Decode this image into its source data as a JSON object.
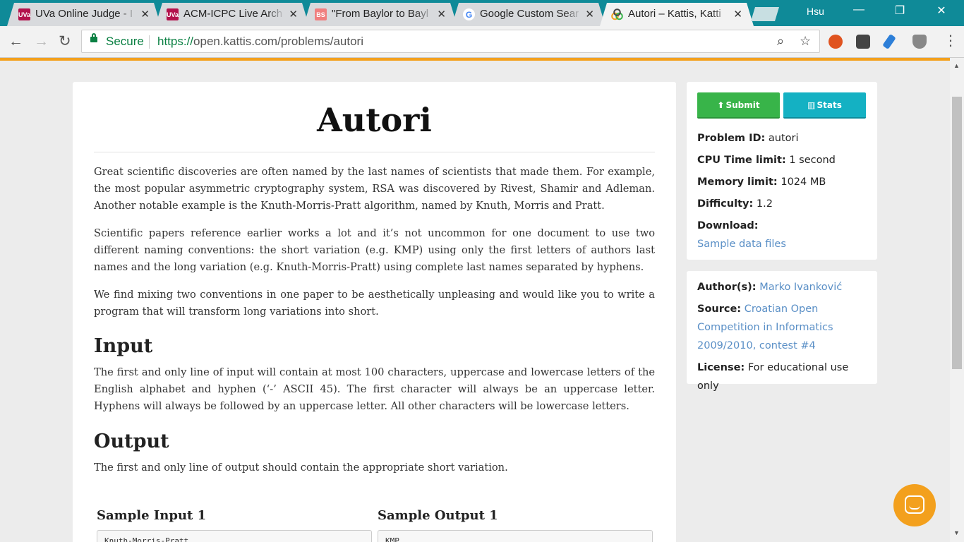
{
  "browser": {
    "tabs": [
      {
        "icon": "uva-favicon",
        "badge": "UVa",
        "color": "#b3124c",
        "title": "UVa Online Judge - I"
      },
      {
        "icon": "uva-favicon",
        "badge": "UVa",
        "color": "#b3124c",
        "title": "ACM-ICPC Live Arch"
      },
      {
        "icon": "bs-favicon",
        "badge": "BS",
        "color": "#f07f7f",
        "title": "\"From Baylor to Bayl"
      },
      {
        "icon": "google-favicon",
        "badge": "G",
        "color": "#4285f4",
        "title": "Google Custom Sear"
      },
      {
        "icon": "kattis-favicon",
        "badge": "",
        "color": "#f3a01d",
        "title": "Autori – Kattis, Katti"
      }
    ],
    "profile_name": "Hsu",
    "secure_label": "Secure",
    "url_scheme": "https://",
    "url_host": "open.kattis.com",
    "url_path": "/problems/autori"
  },
  "colors": {
    "accent": "#f3a01d",
    "submit": "#38b449",
    "stats": "#14b1c3",
    "link": "#5a8fc6"
  },
  "problem": {
    "title": "Autori",
    "intro_p1": "Great scientific discoveries are often named by the last names of scientists that made them. For example, the most popular asymmetric cryptography system, RSA was discovered by Rivest, Shamir and Adleman. Another notable example is the Knuth-Morris-Pratt algorithm, named by Knuth, Morris and Pratt.",
    "intro_p2": "Scientific papers reference earlier works a lot and it’s not uncommon for one document to use two different naming conventions: the short variation (e.g. KMP) using only the first letters of authors last names and the long variation (e.g. Knuth-Morris-Pratt) using complete last names separated by hyphens.",
    "intro_p3": "We find mixing two conventions in one paper to be aesthetically unpleasing and would like you to write a program that will transform long variations into short.",
    "input_heading": "Input",
    "input_text": "The first and only line of input will contain at most 100 characters, uppercase and lowercase letters of the English alphabet and hyphen (‘-’ ASCII 45). The first character will always be an uppercase letter. Hyphens will always be followed by an uppercase letter. All other characters will be lowercase letters.",
    "output_heading": "Output",
    "output_text": "The first and only line of output should contain the appropriate short variation.",
    "sample_input_heading": "Sample Input 1",
    "sample_output_heading": "Sample Output 1",
    "sample_input": "Knuth-Morris-Pratt",
    "sample_output": "KMP"
  },
  "sidebar": {
    "submit_label": "Submit",
    "stats_label": "Stats",
    "problem_id_label": "Problem ID:",
    "problem_id": "autori",
    "cpu_label": "CPU Time limit:",
    "cpu_value": "1 second",
    "memory_label": "Memory limit:",
    "memory_value": "1024 MB",
    "difficulty_label": "Difficulty:",
    "difficulty_value": "1.2",
    "download_label": "Download:",
    "download_link": "Sample data files",
    "authors_label": "Author(s):",
    "authors_value": "Marko Ivanković",
    "source_label": "Source:",
    "source_value": "Croatian Open Competition in Informatics 2009/2010, contest #4",
    "license_label": "License:",
    "license_value": "For educational use only"
  }
}
